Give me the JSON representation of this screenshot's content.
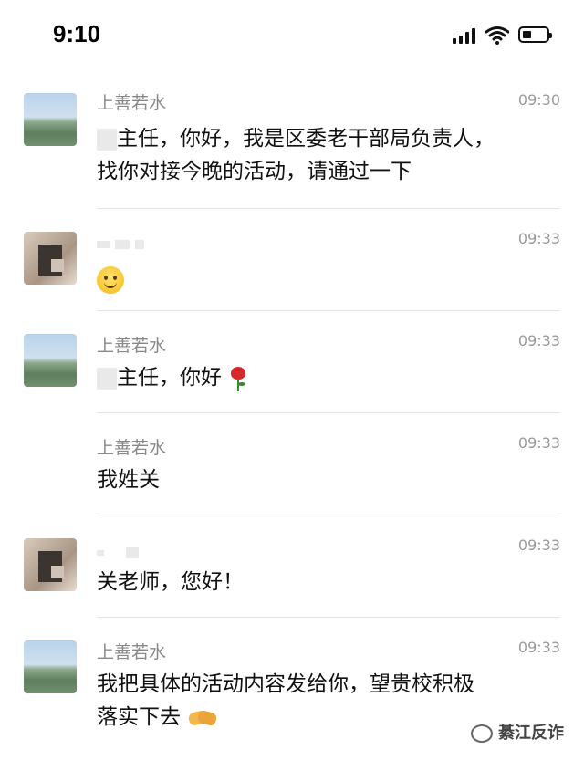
{
  "status_bar": {
    "time": "9:10"
  },
  "messages": [
    {
      "sender": "上善若水",
      "time": "09:30",
      "text_lead": "主任，你好，我是区委老干部局负责人，",
      "text_line2": "找你对接今晚的活动，请通过一下"
    },
    {
      "sender": "",
      "time": "09:33",
      "emoji": "smile-emoji"
    },
    {
      "sender": "上善若水",
      "time": "09:33",
      "text": "主任，你好",
      "emoji": "rose-emoji"
    },
    {
      "sender": "上善若水",
      "time": "09:33",
      "text": "我姓关"
    },
    {
      "sender": "",
      "time": "09:33",
      "text": "关老师，您好！"
    },
    {
      "sender": "上善若水",
      "time": "09:33",
      "text_line1": "我把具体的活动内容发给你，望贵校积极",
      "text_line2": "落实下去",
      "emoji": "handshake-emoji"
    }
  ],
  "watermark": {
    "text": "綦江反诈"
  }
}
